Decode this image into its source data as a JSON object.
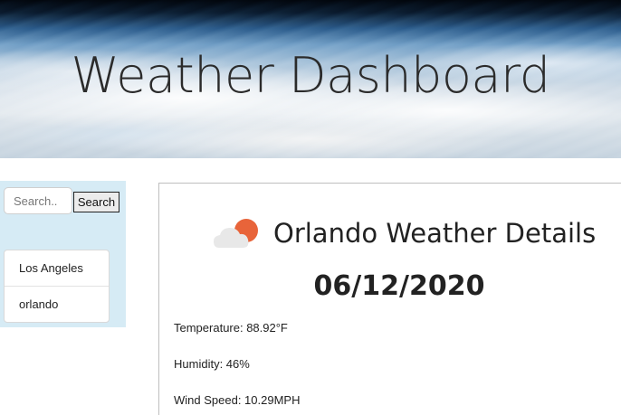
{
  "header": {
    "title": "Weather Dashboard"
  },
  "sidebar": {
    "search": {
      "placeholder": "Search..",
      "value": "",
      "button_label": "Search"
    },
    "history": [
      {
        "label": "Los Angeles"
      },
      {
        "label": "orlando"
      }
    ]
  },
  "details": {
    "icon": "partly-cloudy-sun-icon",
    "title": "Orlando Weather Details",
    "date": "06/12/2020",
    "temperature": "Temperature: 88.92°F",
    "humidity": "Humidity: 46%",
    "wind_speed": "Wind Speed: 10.29MPH"
  },
  "colors": {
    "sidebar_background": "#d6ebf5",
    "sun": "#e8643a",
    "cloud": "#e8e8e8"
  }
}
